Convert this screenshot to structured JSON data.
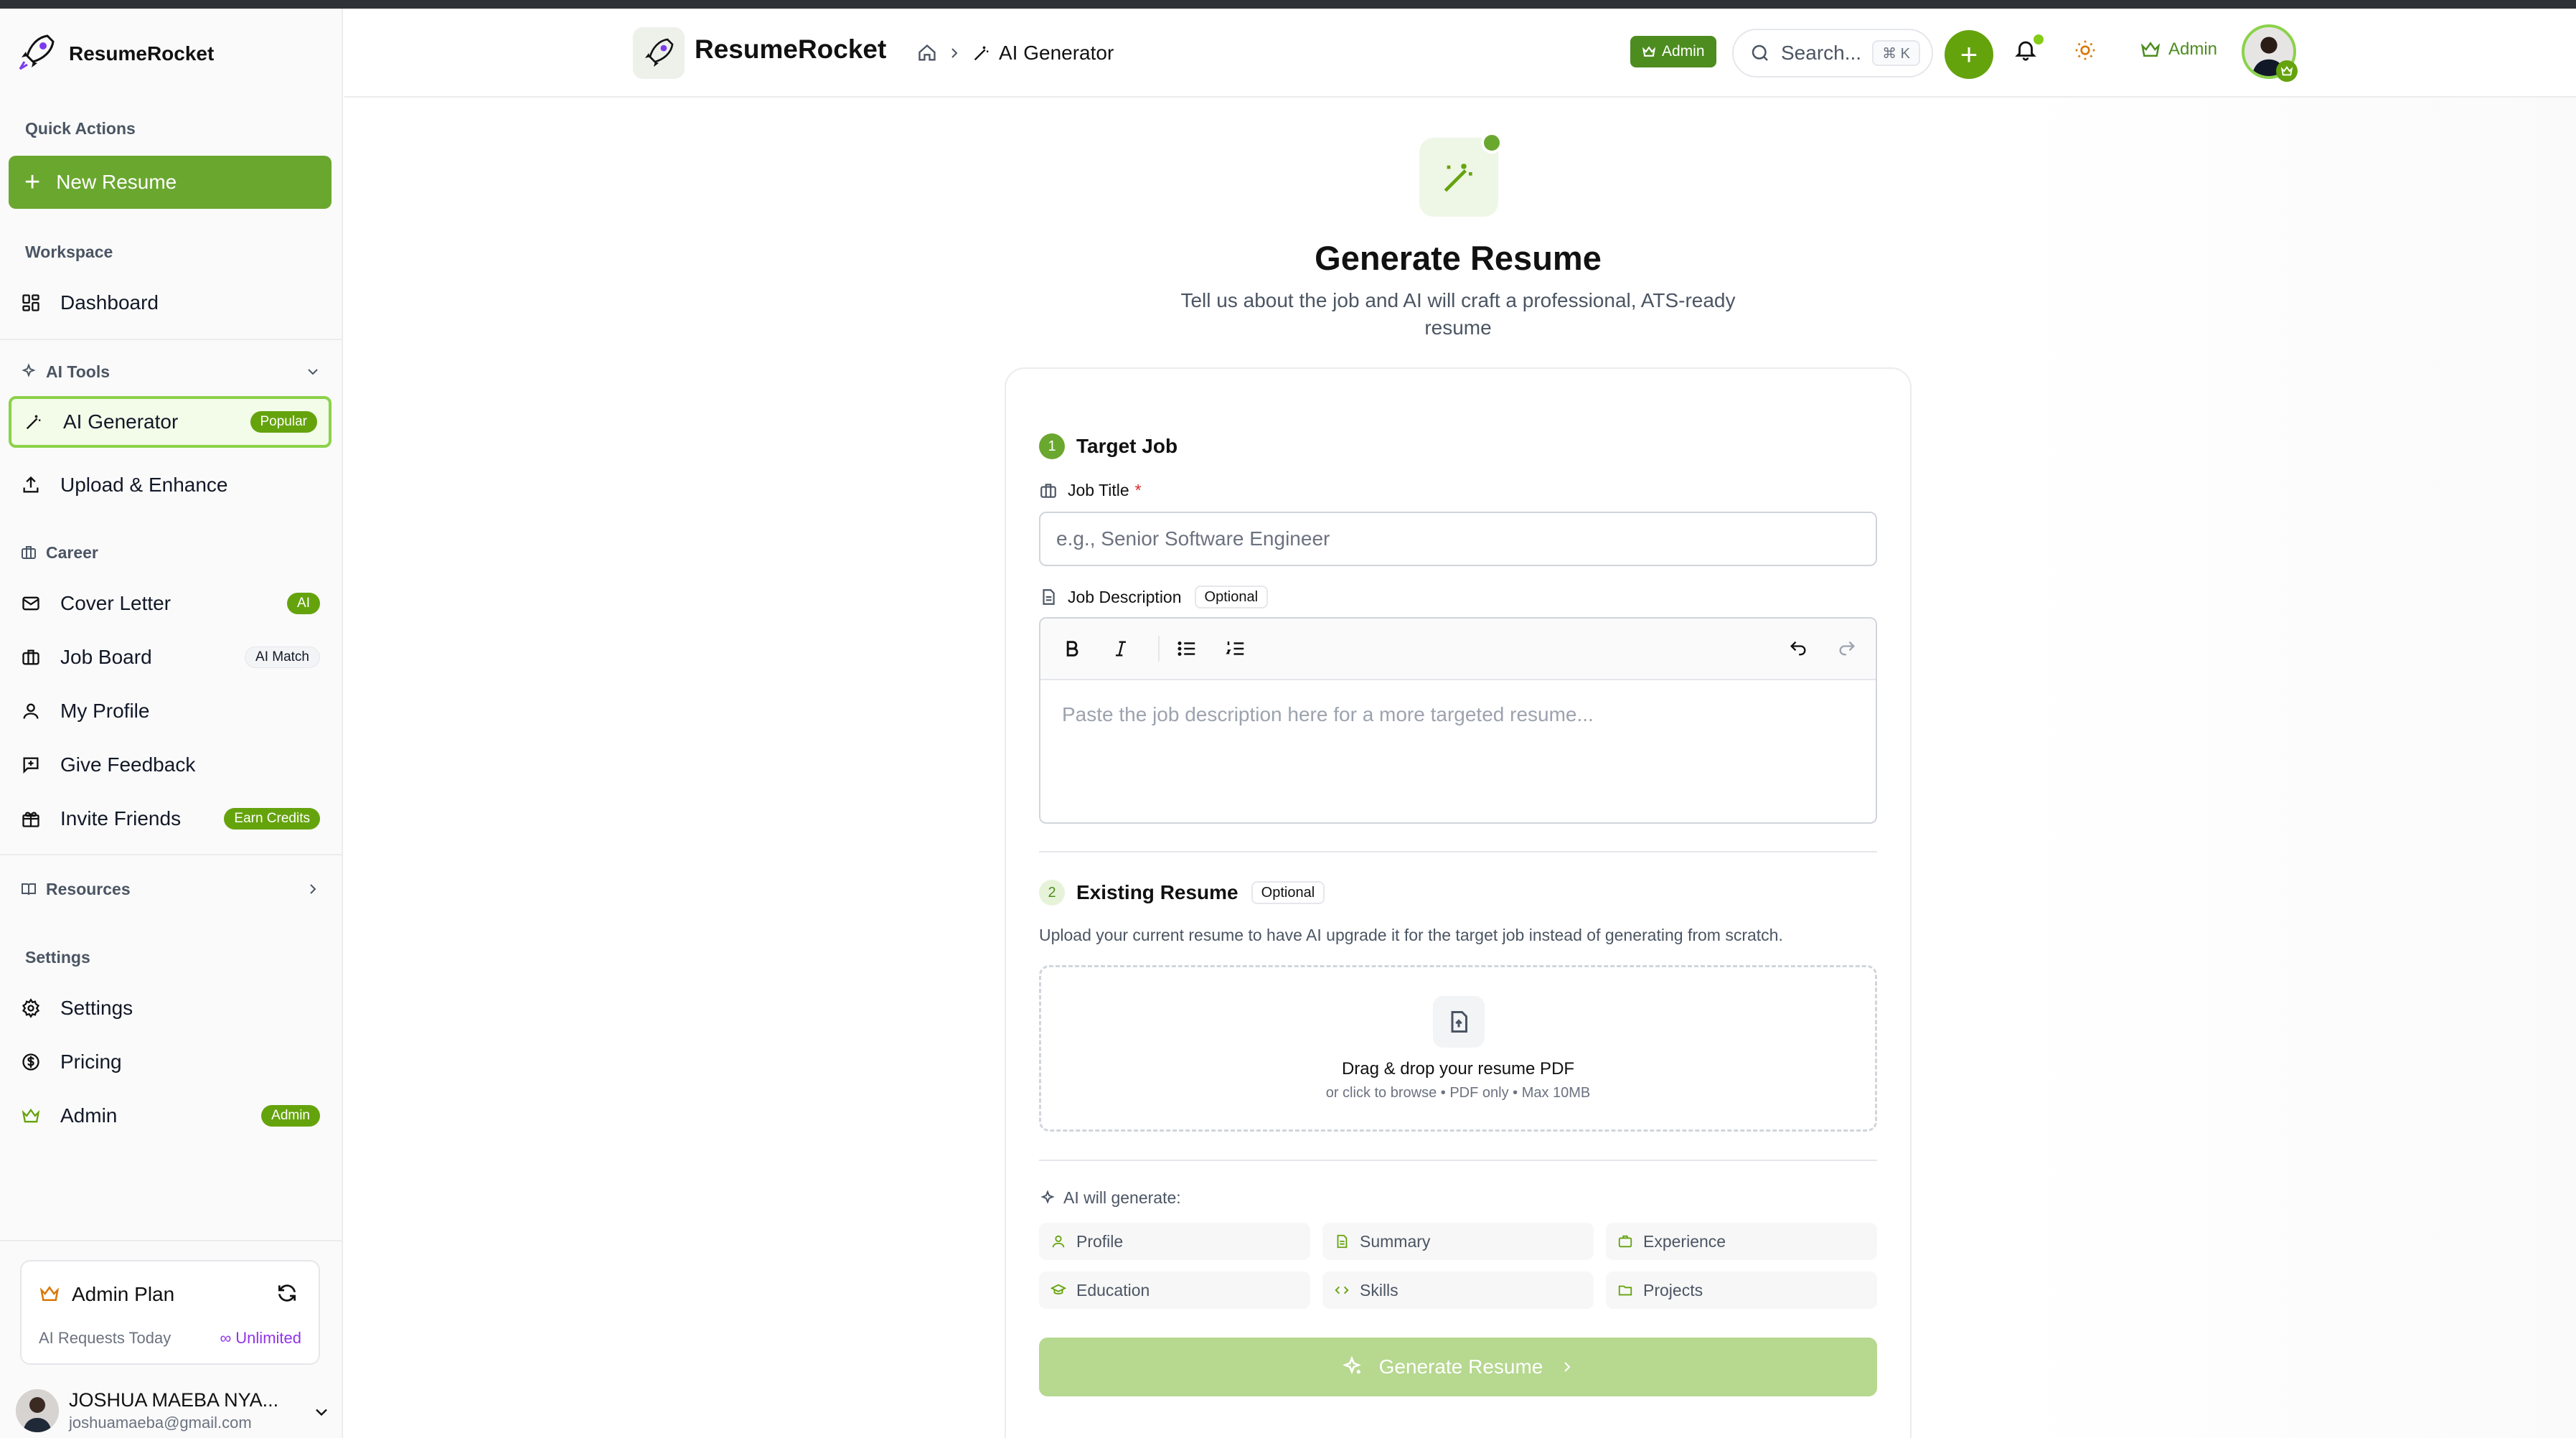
{
  "app": {
    "name": "ResumeRocket",
    "accent": "#65a30d"
  },
  "sidebar": {
    "quick_actions_label": "Quick Actions",
    "new_resume_label": "New Resume",
    "workspace_label": "Workspace",
    "dashboard_label": "Dashboard",
    "ai_tools_label": "AI Tools",
    "ai_generator_label": "AI Generator",
    "ai_generator_badge": "Popular",
    "upload_enhance_label": "Upload & Enhance",
    "career_label": "Career",
    "cover_letter_label": "Cover Letter",
    "cover_letter_badge": "AI",
    "job_board_label": "Job Board",
    "job_board_badge": "AI Match",
    "my_profile_label": "My Profile",
    "give_feedback_label": "Give Feedback",
    "invite_friends_label": "Invite Friends",
    "invite_friends_badge": "Earn Credits",
    "resources_label": "Resources",
    "settings_section_label": "Settings",
    "settings_label": "Settings",
    "pricing_label": "Pricing",
    "admin_label": "Admin",
    "admin_badge": "Admin",
    "plan": {
      "title": "Admin Plan",
      "requests_label": "AI Requests Today",
      "requests_value": "∞ Unlimited"
    },
    "user": {
      "name": "JOSHUA MAEBA NYA...",
      "email": "joshuamaeba@gmail.com"
    }
  },
  "header": {
    "brand": "ResumeRocket",
    "breadcrumb_current": "AI Generator",
    "admin_badge": "Admin",
    "search_placeholder": "Search...",
    "search_shortcut": "⌘ K",
    "admin_link": "Admin"
  },
  "main": {
    "title": "Generate Resume",
    "subtitle": "Tell us about the job and AI will craft a professional, ATS-ready resume",
    "step1": {
      "number": "1",
      "title": "Target Job",
      "job_title_label": "Job Title",
      "job_title_required": "*",
      "job_title_placeholder": "e.g., Senior Software Engineer",
      "job_desc_label": "Job Description",
      "job_desc_optional": "Optional",
      "job_desc_placeholder": "Paste the job description here for a more targeted resume..."
    },
    "step2": {
      "number": "2",
      "title": "Existing Resume",
      "optional": "Optional",
      "description": "Upload your current resume to have AI upgrade it for the target job instead of generating from scratch.",
      "drop_title": "Drag & drop your resume PDF",
      "drop_sub": "or click to browse • PDF only • Max 10MB"
    },
    "generates_label": "AI will generate:",
    "generates": [
      "Profile",
      "Summary",
      "Experience",
      "Education",
      "Skills",
      "Projects"
    ],
    "generate_button": "Generate Resume"
  }
}
